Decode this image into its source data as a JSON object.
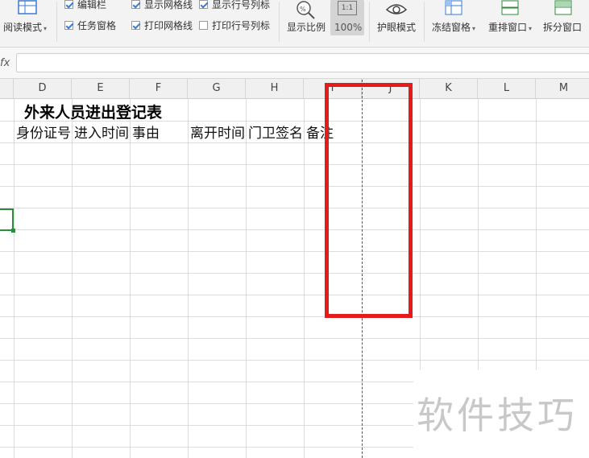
{
  "ribbon": {
    "reading_mode": "阅读模式",
    "checkboxes": [
      {
        "label": "编辑栏",
        "checked": true
      },
      {
        "label": "显示网格线",
        "checked": true
      },
      {
        "label": "显示行号列标",
        "checked": true
      },
      {
        "label": "任务窗格",
        "checked": true
      },
      {
        "label": "打印网格线",
        "checked": true
      },
      {
        "label": "打印行号列标",
        "checked": false
      }
    ],
    "zoom_label": "显示比例",
    "zoom_value": "100%",
    "zoom_icon_text": "1:1",
    "eye_mode": "护眼模式",
    "freeze_panes": "冻结窗格",
    "arrange_windows": "重排窗口",
    "split_window": "拆分窗口"
  },
  "formula_bar": {
    "fx": "fx",
    "value": ""
  },
  "columns": [
    "D",
    "E",
    "F",
    "G",
    "H",
    "I",
    "J",
    "K",
    "L",
    "M"
  ],
  "sheet": {
    "title": "外来人员进出登记表",
    "headers": [
      "身份证号",
      "进入时间",
      "事由",
      "",
      "离开时间",
      "门卫签名",
      "备注"
    ]
  },
  "watermark": "软件技巧",
  "colors": {
    "highlight": "#e31b1b",
    "active_cell": "#2e8b3d",
    "checkbox_check": "#3a7bd5"
  }
}
